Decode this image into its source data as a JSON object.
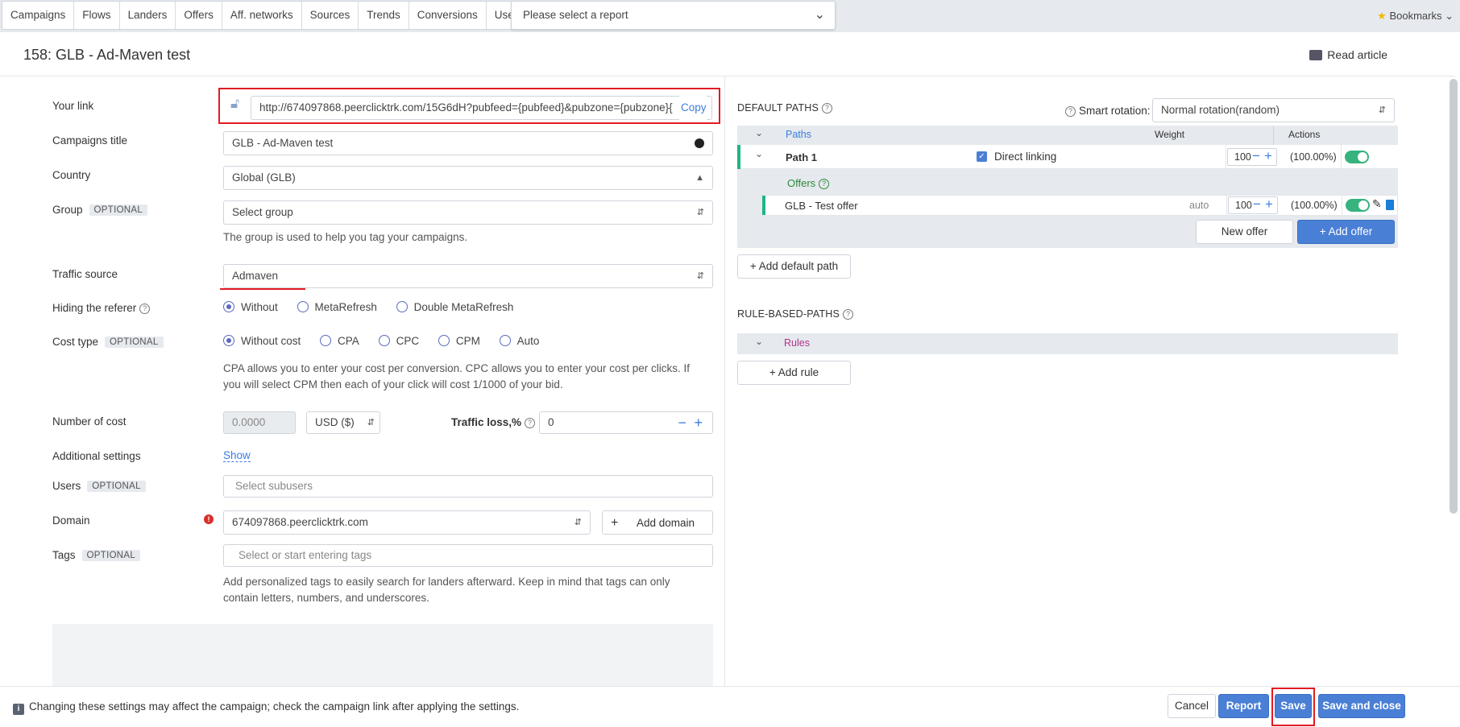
{
  "nav": {
    "tabs": [
      "Campaigns",
      "Flows",
      "Landers",
      "Offers",
      "Aff. networks",
      "Sources",
      "Trends",
      "Conversions",
      "Users"
    ],
    "report_placeholder": "Please select a report",
    "bookmarks": "Bookmarks"
  },
  "header": {
    "title": "158: GLB - Ad-Maven test",
    "read_article": "Read article"
  },
  "form": {
    "your_link": {
      "label": "Your link",
      "value": "http://674097868.peerclicktrk.com/15G6dH?pubfeed={pubfeed}&pubzone={pubzone}{",
      "copy": "Copy"
    },
    "title": {
      "label": "Campaigns title",
      "value": "GLB - Ad-Maven test"
    },
    "country": {
      "label": "Country",
      "value": "Global (GLB)"
    },
    "group": {
      "label": "Group",
      "optional": "OPTIONAL",
      "placeholder": "Select group",
      "help": "The group is used to help you tag your campaigns."
    },
    "traffic_source": {
      "label": "Traffic source",
      "value": "Admaven"
    },
    "hiding_referer": {
      "label": "Hiding the referer",
      "options": [
        "Without",
        "MetaRefresh",
        "Double MetaRefresh"
      ],
      "selected": 0
    },
    "cost_type": {
      "label": "Cost type",
      "optional": "OPTIONAL",
      "options": [
        "Without cost",
        "CPA",
        "CPC",
        "CPM",
        "Auto"
      ],
      "selected": 0,
      "help_line1": "CPA allows you to enter your cost per conversion. CPC allows you to enter your cost per clicks. If",
      "help_line2": "you will select CPM then each of your click will cost 1/1000 of your bid."
    },
    "number_of_cost": {
      "label": "Number of cost",
      "placeholder": "0.0000",
      "currency": "USD ($)"
    },
    "traffic_loss": {
      "label": "Traffic loss,%",
      "value": "0"
    },
    "additional": {
      "label": "Additional settings",
      "link": "Show"
    },
    "users": {
      "label": "Users",
      "optional": "OPTIONAL",
      "placeholder": "Select subusers"
    },
    "domain": {
      "label": "Domain",
      "value": "674097868.peerclicktrk.com",
      "add": "Add domain"
    },
    "tags": {
      "label": "Tags",
      "optional": "OPTIONAL",
      "placeholder": "Select or start entering tags",
      "help_line1": "Add personalized tags to easily search for landers afterward. Keep in mind that tags can only",
      "help_line2": "contain letters, numbers, and underscores."
    }
  },
  "paths": {
    "default_title": "DEFAULT PATHS",
    "smart_rotation_label": "Smart rotation:",
    "smart_rotation_value": "Normal rotation(random)",
    "col_paths": "Paths",
    "col_weight": "Weight",
    "col_actions": "Actions",
    "path1": {
      "name": "Path 1",
      "direct_linking": "Direct linking",
      "weight": "100",
      "percent": "(100.00%)"
    },
    "offers_title": "Offers",
    "offer1": {
      "name": "GLB - Test offer",
      "mode": "auto",
      "weight": "100",
      "percent": "(100.00%)"
    },
    "new_offer": "New offer",
    "add_offer": "Add offer",
    "add_default_path": "Add default path",
    "rule_title": "RULE-BASED-PATHS",
    "rules": "Rules",
    "add_rule": "Add rule"
  },
  "footer": {
    "note": "Changing these settings may affect the campaign; check the campaign link after applying the settings.",
    "cancel": "Cancel",
    "report": "Report",
    "save": "Save",
    "save_close": "Save and close"
  },
  "colors": {
    "accent": "#4a7fd6",
    "highlight": "#e31b23",
    "toggle": "#36b37e"
  }
}
